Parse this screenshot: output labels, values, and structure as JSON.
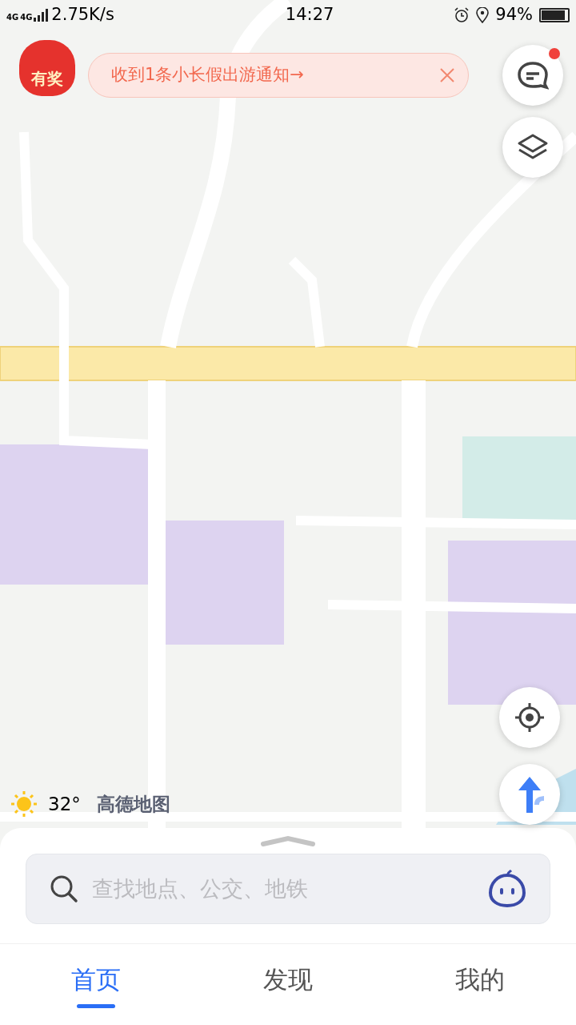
{
  "status_bar": {
    "network": [
      "4G",
      "4G"
    ],
    "speed": "2.75K/s",
    "time": "14:27",
    "battery": "94%"
  },
  "promo_badge": {
    "label": "有奖"
  },
  "notification": {
    "text": "收到1条小长假出游通知→"
  },
  "messages": {
    "unread": true
  },
  "weather": {
    "temperature": "32°"
  },
  "logo": {
    "text": "高德地图"
  },
  "search": {
    "placeholder": "查找地点、公交、地铁"
  },
  "tabs": [
    {
      "label": "首页",
      "selected": true
    },
    {
      "label": "发现",
      "selected": false
    },
    {
      "label": "我的",
      "selected": false
    }
  ]
}
